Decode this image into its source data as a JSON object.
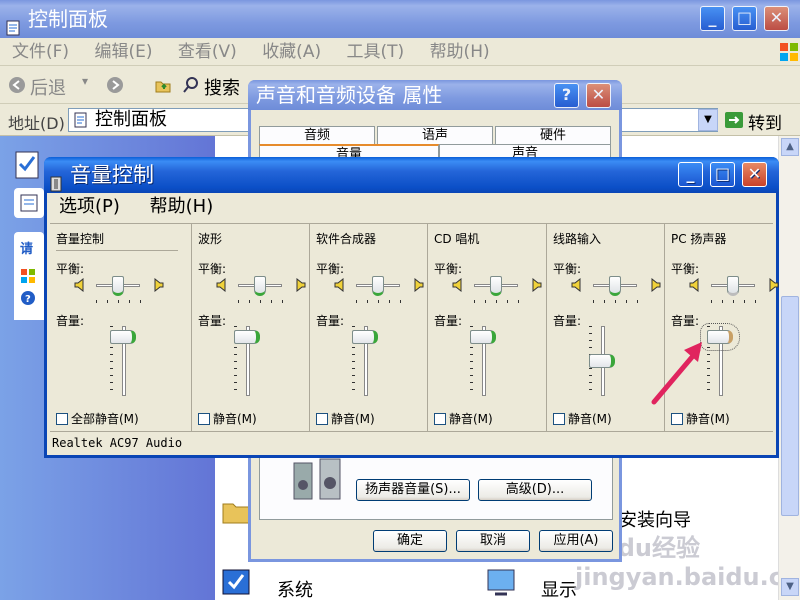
{
  "control_panel": {
    "title": "控制面板",
    "menu": [
      "文件(F)",
      "编辑(E)",
      "查看(V)",
      "收藏(A)",
      "工具(T)",
      "帮助(H)"
    ],
    "toolbar": {
      "back": "后退",
      "search": "搜索"
    },
    "address_label": "地址(D)",
    "address_value": "控制面板",
    "go_label": "转到",
    "side_labels": [
      "请"
    ],
    "items": [
      "系统",
      "显示"
    ],
    "wizard_label": "安装向导"
  },
  "sound_dialog": {
    "title": "声音和音频设备 属性",
    "tabs_row1": [
      "音频",
      "语声",
      "硬件"
    ],
    "tabs_row2": [
      "音量",
      "声音"
    ],
    "speaker_volume_button": "扬声器音量(S)...",
    "advanced_button": "高级(D)...",
    "ok": "确定",
    "cancel": "取消",
    "apply": "应用(A)"
  },
  "volume_control": {
    "title": "音量控制",
    "menu": [
      "选项(P)",
      "帮助(H)"
    ],
    "balance_label": "平衡:",
    "volume_label": "音量:",
    "status": "Realtek AC97 Audio",
    "channels": [
      {
        "name": "音量控制",
        "mute_label": "全部静音(M)",
        "muted": false,
        "volume": 0.92,
        "balance": 0.5,
        "enabled": true
      },
      {
        "name": "波形",
        "mute_label": "静音(M)",
        "muted": false,
        "volume": 0.92,
        "balance": 0.5,
        "enabled": true
      },
      {
        "name": "软件合成器",
        "mute_label": "静音(M)",
        "muted": false,
        "volume": 0.92,
        "balance": 0.5,
        "enabled": true
      },
      {
        "name": "CD 唱机",
        "mute_label": "静音(M)",
        "muted": false,
        "volume": 0.92,
        "balance": 0.5,
        "enabled": true
      },
      {
        "name": "线路输入",
        "mute_label": "静音(M)",
        "muted": false,
        "volume": 0.5,
        "balance": 0.5,
        "enabled": true
      },
      {
        "name": "PC 扬声器",
        "mute_label": "静音(M)",
        "muted": false,
        "volume": 0.92,
        "balance": 0.5,
        "enabled": false
      }
    ]
  },
  "watermark": "Baidu经验 jingyan.baidu.com",
  "colors": {
    "accent": "#0a45b5",
    "slider_active": "#3aa63a",
    "annotation_arrow": "#e0245e"
  }
}
